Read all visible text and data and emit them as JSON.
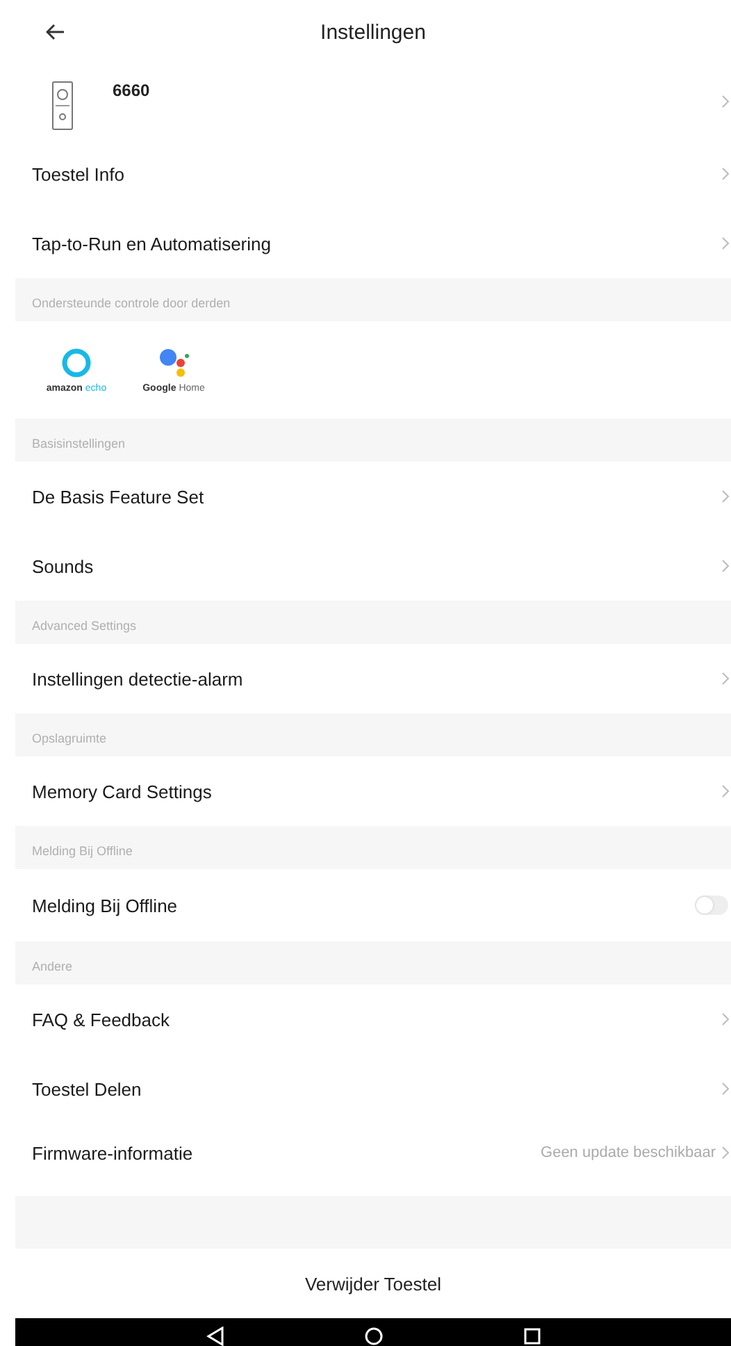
{
  "header": {
    "title": "Instellingen"
  },
  "device": {
    "name": "6660"
  },
  "entries": [
    {
      "kind": "row",
      "label": "Toestel Info"
    },
    {
      "kind": "row",
      "label": "Tap-to-Run en Automatisering"
    },
    {
      "kind": "header",
      "label": "Ondersteunde controle door derden"
    },
    {
      "kind": "integrations",
      "items": [
        {
          "kind": "alexa",
          "label_a": "amazon",
          "label_b": "echo"
        },
        {
          "kind": "google",
          "label_a": "Google",
          "label_b": "Home"
        }
      ]
    },
    {
      "kind": "header",
      "label": "Basisinstellingen"
    },
    {
      "kind": "row",
      "label": "De Basis Feature Set"
    },
    {
      "kind": "row",
      "label": "Sounds"
    },
    {
      "kind": "header",
      "label": "Advanced Settings"
    },
    {
      "kind": "row",
      "label": "Instellingen detectie-alarm"
    },
    {
      "kind": "header",
      "label": "Opslagruimte"
    },
    {
      "kind": "row",
      "label": "Memory Card Settings"
    },
    {
      "kind": "header",
      "label": "Melding Bij Offline"
    },
    {
      "kind": "toggle",
      "label": "Melding Bij Offline",
      "on": false
    },
    {
      "kind": "header",
      "label": "Andere"
    },
    {
      "kind": "row",
      "label": "FAQ & Feedback"
    },
    {
      "kind": "row",
      "label": "Toestel Delen"
    },
    {
      "kind": "row",
      "label": "Firmware-informatie",
      "value": "Geen update beschikbaar"
    }
  ],
  "remove_button": "Verwijder Toestel"
}
